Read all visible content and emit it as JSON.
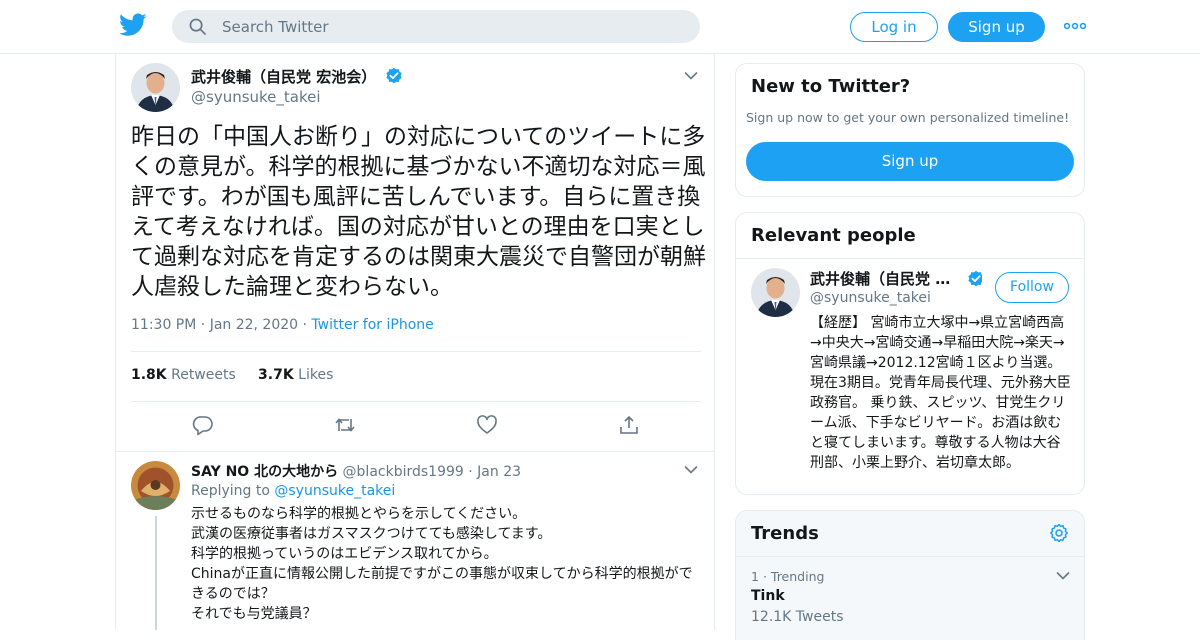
{
  "header": {
    "search_placeholder": "Search Twitter",
    "login_label": "Log in",
    "signup_label": "Sign up"
  },
  "tweet": {
    "author_name": "武井俊輔（自民党 宏池会）",
    "author_handle": "@syunsuke_takei",
    "text": "昨日の「中国人お断り」の対応についてのツイートに多くの意見が。科学的根拠に基づかない不適切な対応＝風評です。わが国も風評に苦しんでいます。自らに置き換えて考えなければ。国の対応が甘いとの理由を口実として過剰な対応を肯定するのは関東大震災で自警団が朝鮮人虐殺した論理と変わらない。",
    "time": "11:30 PM",
    "date": "Jan 22, 2020",
    "source": "Twitter for iPhone",
    "retweets_count": "1.8K",
    "retweets_label": "Retweets",
    "likes_count": "3.7K",
    "likes_label": "Likes"
  },
  "reply": {
    "author_name": "SAY NO 北の大地から",
    "author_handle": "@blackbirds1999",
    "date": "Jan 23",
    "replying_label": "Replying to",
    "replying_handle": "@syunsuke_takei",
    "lines": [
      "示せるものなら科学的根拠とやらを示してください。",
      "武漢の医療従事者はガスマスクつけてても感染してます。",
      "科学的根拠っていうのはエビデンス取れてから。",
      "Chinaが正直に情報公開した前提ですがこの事態が収束してから科学的根拠ができるのでは？",
      "それでも与党議員？"
    ]
  },
  "new_to_twitter": {
    "title": "New to Twitter?",
    "subtitle": "Sign up now to get your own personalized timeline!",
    "button": "Sign up"
  },
  "relevant_people": {
    "title": "Relevant people",
    "name": "武井俊輔（自民党 宏池会）",
    "handle": "@syunsuke_takei",
    "follow_label": "Follow",
    "bio": "【経歴】 宮崎市立大塚中→県立宮崎西高→中央大→宮崎交通→早稲田大院→楽天→宮崎県議→2012.12宮崎１区より当選。現在3期目。党青年局長代理、元外務大臣政務官。 乗り鉄、スピッツ、甘党生クリーム派、下手なビリヤード。お酒は飲むと寝てしまいます。尊敬する人物は大谷刑部、小栗上野介、岩切章太郎。"
  },
  "trends": {
    "title": "Trends",
    "items": [
      {
        "rank": "1",
        "context": "Trending",
        "name": "Tink",
        "count": "12.1K Tweets"
      }
    ]
  },
  "colors": {
    "accent": "#1da1f2",
    "link": "#1b95e0",
    "muted": "#657786",
    "border": "#e6ecf0"
  },
  "icons": [
    "twitter-logo-icon",
    "search-icon",
    "more-icon",
    "verified-icon",
    "chevron-down-icon",
    "reply-icon",
    "retweet-icon",
    "like-icon",
    "share-icon",
    "gear-icon"
  ]
}
